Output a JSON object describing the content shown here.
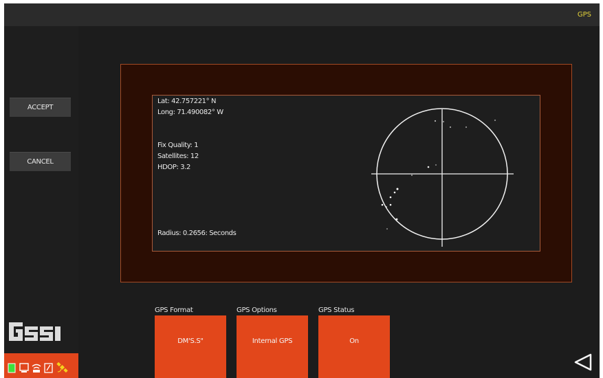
{
  "topbar": {
    "title": "GPS"
  },
  "sidebar": {
    "accept_label": "ACCEPT",
    "cancel_label": "CANCEL",
    "logo_text": "GSSI",
    "status_icons": [
      "battery-icon",
      "screen-icon",
      "wifi-icon",
      "sd-card-icon",
      "gps-satellite-icon"
    ]
  },
  "gps": {
    "lat": "Lat: 42.757221° N",
    "long": "Long: 71.490082° W",
    "fix_quality": "Fix Quality: 1",
    "satellites": "Satellites: 12",
    "hdop": "HDOP: 3.2",
    "radius": "Radius: 0.2656: Seconds"
  },
  "fields": [
    {
      "label": "GPS Format",
      "value": "DM'S.S\""
    },
    {
      "label": "GPS Options",
      "value": "Internal GPS"
    },
    {
      "label": "GPS Status",
      "value": "On"
    }
  ],
  "colors": {
    "accent": "#e2471b",
    "title": "#e3d23a",
    "dialog_bg": "#2b0d03",
    "panel_bg": "#1e1e1e"
  },
  "navigation": {
    "back_icon": "back-triangle-icon"
  }
}
